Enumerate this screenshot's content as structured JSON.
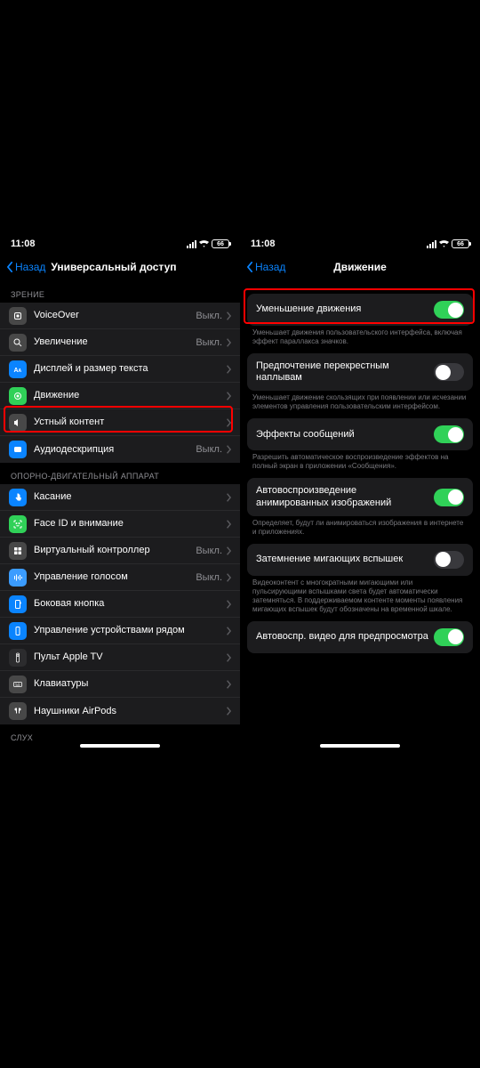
{
  "status": {
    "time": "11:08",
    "battery": "66"
  },
  "screenA": {
    "back": "Назад",
    "title": "Универсальный доступ",
    "sections": {
      "vision": "ЗРЕНИЕ",
      "motor": "ОПОРНО-ДВИГАТЕЛЬНЫЙ АППАРАТ",
      "hearing": "СЛУХ"
    },
    "rows": {
      "voiceover": {
        "label": "VoiceOver",
        "value": "Выкл."
      },
      "zoom": {
        "label": "Увеличение",
        "value": "Выкл."
      },
      "display": {
        "label": "Дисплей и размер текста",
        "value": ""
      },
      "motion": {
        "label": "Движение",
        "value": ""
      },
      "spoken": {
        "label": "Устный контент",
        "value": ""
      },
      "audiodesc": {
        "label": "Аудиодескрипция",
        "value": "Выкл."
      },
      "touch": {
        "label": "Касание",
        "value": ""
      },
      "faceid": {
        "label": "Face ID и внимание",
        "value": ""
      },
      "switchctl": {
        "label": "Виртуальный контроллер",
        "value": "Выкл."
      },
      "voicectrl": {
        "label": "Управление голосом",
        "value": "Выкл."
      },
      "sidebtn": {
        "label": "Боковая кнопка",
        "value": ""
      },
      "nearby": {
        "label": "Управление устройствами рядом",
        "value": ""
      },
      "appletv": {
        "label": "Пульт Apple TV",
        "value": ""
      },
      "keyboards": {
        "label": "Клавиатуры",
        "value": ""
      },
      "airpods": {
        "label": "Наушники AirPods",
        "value": ""
      }
    }
  },
  "screenB": {
    "back": "Назад",
    "title": "Движение",
    "rows": {
      "reduce": {
        "label": "Уменьшение движения"
      },
      "reduce_note": "Уменьшает движения пользовательского интерфейса, включая эффект параллакса значков.",
      "crossfade": {
        "label": "Предпочтение перекрестным наплывам"
      },
      "crossfade_note": "Уменьшает движение скользящих при появлении или исчезании элементов управления пользовательским интерфейсом.",
      "msgfx": {
        "label": "Эффекты сообщений"
      },
      "msgfx_note": "Разрешить автоматическое воспроизведение эффектов на полный экран в приложении «Сообщения».",
      "autoplay": {
        "label": "Автовоспроизведение анимированных изображений"
      },
      "autoplay_note": "Определяет, будут ли анимироваться изображения в интернете и приложениях.",
      "dimflash": {
        "label": "Затемнение мигающих вспышек"
      },
      "dimflash_note": "Видеоконтент с многократными мигающими или пульсирующими вспышками света будет автоматически затемняться. В поддерживаемом контенте моменты появления мигающих вспышек будут обозначены на временной шкале.",
      "autoprev": {
        "label": "Автовоспр. видео для предпросмотра"
      }
    }
  }
}
